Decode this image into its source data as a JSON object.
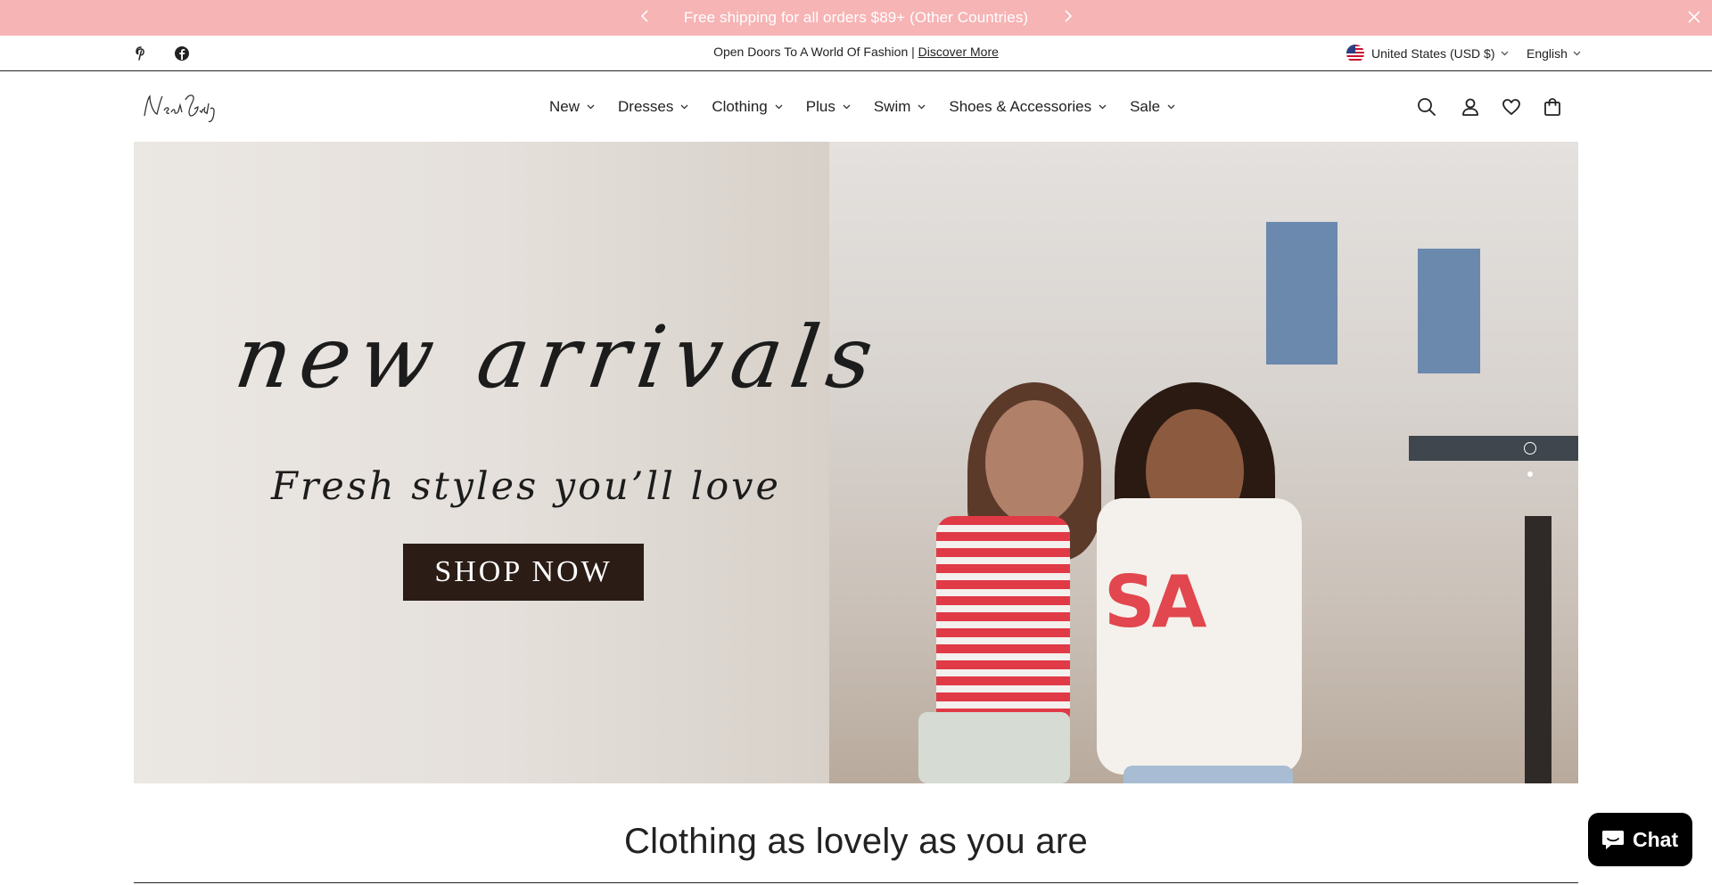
{
  "announcement": {
    "text": "Free shipping for all orders $89+ (Other Countries)",
    "prev_icon": "chevron-left-icon",
    "next_icon": "chevron-right-icon",
    "close_icon": "close-icon",
    "bg_color": "#f6b4b5"
  },
  "utility_bar": {
    "social": [
      "pinterest-icon",
      "facebook-icon"
    ],
    "promo_text": "Open Doors To A World Of Fashion | ",
    "promo_link": "Discover More",
    "country": "United States (USD $)",
    "language": "English"
  },
  "header": {
    "logo_text": "NeatGirly",
    "nav": [
      {
        "label": "New"
      },
      {
        "label": "Dresses"
      },
      {
        "label": "Clothing"
      },
      {
        "label": "Plus"
      },
      {
        "label": "Swim"
      },
      {
        "label": "Shoes & Accessories"
      },
      {
        "label": "Sale"
      }
    ],
    "icons": [
      "search-icon",
      "account-icon",
      "wishlist-icon",
      "cart-icon"
    ]
  },
  "hero": {
    "script_text": "new arrivals",
    "subtitle": "Fresh styles you’ll love",
    "cta": "SHOP NOW",
    "slide_count": 2,
    "active_slide": 1,
    "usa_text": "SA",
    "cta_color": "#2b1c16"
  },
  "section": {
    "title": "Clothing as lovely as you are"
  },
  "chat": {
    "label": "Chat"
  }
}
